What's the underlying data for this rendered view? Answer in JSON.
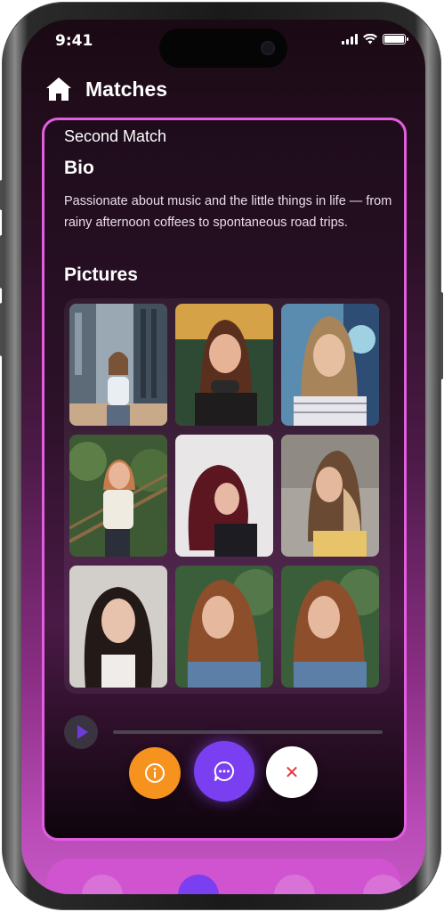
{
  "status_bar": {
    "time": "9:41"
  },
  "header": {
    "title": "Matches",
    "icon": "home-icon"
  },
  "card": {
    "subtitle": "Second Match",
    "bio_heading": "Bio",
    "bio_text": "Passionate about music and the little things in life — from rainy afternoon coffees to spontaneous road trips.",
    "pictures_heading": "Pictures",
    "pictures": [
      {
        "name": "photo-1"
      },
      {
        "name": "photo-2"
      },
      {
        "name": "photo-3"
      },
      {
        "name": "photo-4"
      },
      {
        "name": "photo-5"
      },
      {
        "name": "photo-6"
      },
      {
        "name": "photo-7"
      },
      {
        "name": "photo-8"
      },
      {
        "name": "photo-9"
      }
    ]
  },
  "audio_player": {
    "icon": "play-icon",
    "progress": 0
  },
  "actions": [
    {
      "name": "info-button",
      "icon": "info-icon",
      "color": "#f6921e"
    },
    {
      "name": "chat-button",
      "icon": "chat-bubble-icon",
      "color": "#7b3ff2"
    },
    {
      "name": "dismiss-button",
      "icon": "close-icon",
      "color": "#ffffff"
    }
  ],
  "bottom_nav": {
    "items": [
      "home-icon",
      "profile-icon",
      "bookmark-icon",
      "settings-icon"
    ],
    "active": 1
  },
  "colors": {
    "accent": "#e35de0",
    "primary": "#7b3ff2",
    "warning": "#f6921e",
    "danger": "#e0373b"
  }
}
